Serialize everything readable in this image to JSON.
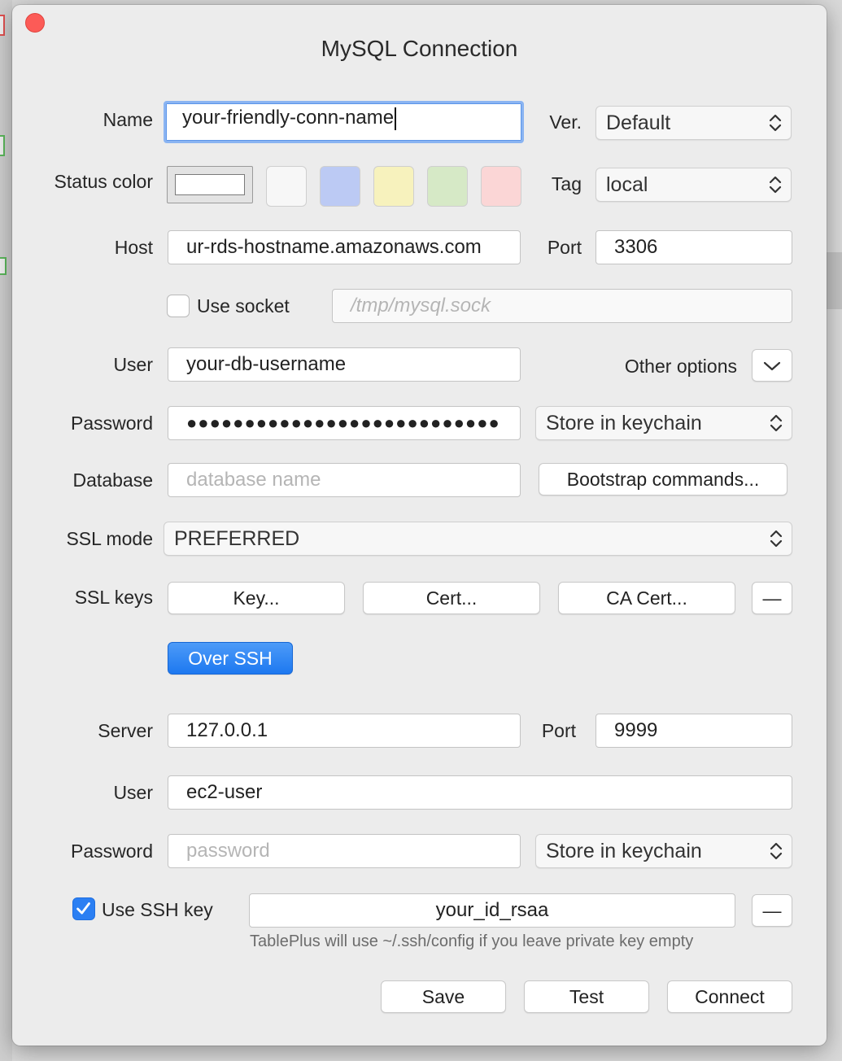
{
  "dialog": {
    "title": "MySQL Connection"
  },
  "colors": {
    "swatches": [
      "#f7f7f7",
      "#bccaf4",
      "#f7f2bd",
      "#d6e9c6",
      "#fbd6d6"
    ],
    "primary": "#1d78f0",
    "close": "#fc5b57"
  },
  "name": {
    "label": "Name",
    "value": "your-friendly-conn-name"
  },
  "version": {
    "label": "Ver.",
    "value": "Default"
  },
  "status_color": {
    "label": "Status color"
  },
  "tag": {
    "label": "Tag",
    "value": "local"
  },
  "host": {
    "label": "Host",
    "value": "ur-rds-hostname.amazonaws.com"
  },
  "port": {
    "label": "Port",
    "value": "3306"
  },
  "socket": {
    "label": "Use socket",
    "placeholder": "/tmp/mysql.sock"
  },
  "user": {
    "label": "User",
    "value": "your-db-username"
  },
  "other_options": {
    "label": "Other options"
  },
  "password": {
    "label": "Password",
    "value": "●●●●●●●●●●●●●●●●●●●●●●●●●●●",
    "store": "Store in keychain"
  },
  "database": {
    "label": "Database",
    "placeholder": "database name",
    "bootstrap": "Bootstrap commands..."
  },
  "ssl": {
    "mode_label": "SSL mode",
    "mode_value": "PREFERRED",
    "keys_label": "SSL keys",
    "key": "Key...",
    "cert": "Cert...",
    "ca_cert": "CA Cert...",
    "remove": "—"
  },
  "over_ssh": "Over SSH",
  "ssh": {
    "server_label": "Server",
    "server_value": "127.0.0.1",
    "port_label": "Port",
    "port_value": "9999",
    "user_label": "User",
    "user_value": "ec2-user",
    "password_label": "Password",
    "password_placeholder": "password",
    "password_store": "Store in keychain",
    "use_key_label": "Use SSH key",
    "key_value": "your_id_rsaa",
    "key_remove": "—",
    "hint": "TablePlus will use ~/.ssh/config if you leave private key empty"
  },
  "footer": {
    "save": "Save",
    "test": "Test",
    "connect": "Connect"
  }
}
